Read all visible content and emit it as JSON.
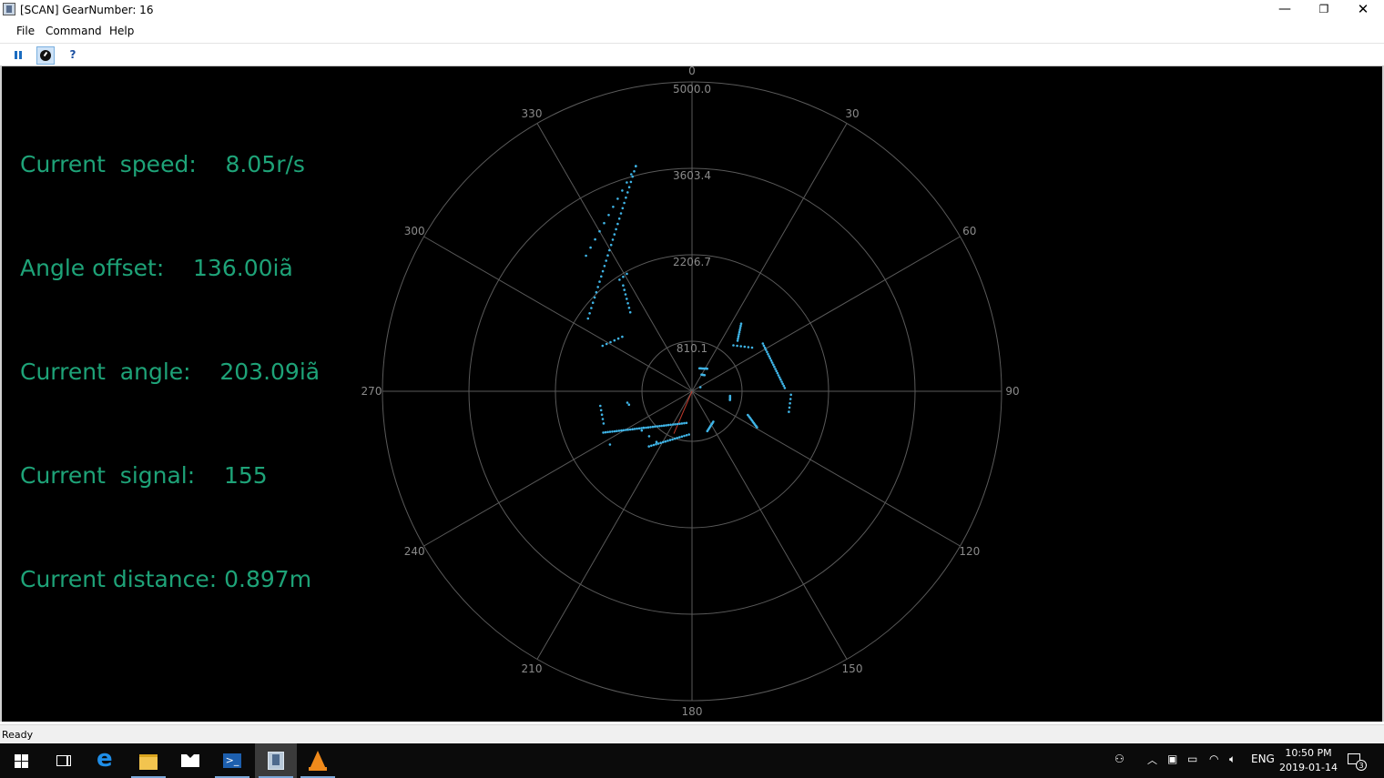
{
  "window": {
    "title": "[SCAN] GearNumber: 16",
    "controls": {
      "minimize": "—",
      "maximize": "❐",
      "close": "✕"
    }
  },
  "menu": {
    "items": [
      "File",
      "Command",
      "Help"
    ]
  },
  "toolbar": {
    "buttons": [
      {
        "name": "pause",
        "icon": "pause-icon"
      },
      {
        "name": "scan",
        "icon": "radar-icon",
        "pressed": true
      },
      {
        "name": "help",
        "icon": "help-icon",
        "label": "?"
      }
    ]
  },
  "info": {
    "speed": "Current  speed:    8.05r/s",
    "offset": "Angle offset:    136.00iã",
    "angle": "Current  angle:    203.09iã",
    "signal": "Current  signal:    155",
    "distance": "Current distance: 0.897m"
  },
  "chart_data": {
    "type": "scatter",
    "coordinate_system": "polar",
    "angle_labels": [
      "0",
      "30",
      "60",
      "90",
      "120",
      "150",
      "180",
      "210",
      "240",
      "270",
      "300",
      "330"
    ],
    "radius_labels": [
      "5000.0",
      "3603.4",
      "2206.7",
      "810.1"
    ],
    "colors": {
      "background": "#000000",
      "grid": "#5a5a5a",
      "points": "#3fb4e6",
      "heading": "#c0392b",
      "text": "#1ea378"
    },
    "heading_angle_deg": 203.09,
    "segments": [
      {
        "from": [
          -14,
          3750
        ],
        "to": [
          -55,
          2050
        ],
        "n": 30
      },
      {
        "from": [
          -14,
          3750
        ],
        "to": [
          -38,
          2780
        ],
        "n": 12
      },
      {
        "from": [
          -33,
          2040
        ],
        "to": [
          -38,
          1620
        ],
        "n": 7
      },
      {
        "from": [
          -29,
          2170
        ],
        "to": [
          -33,
          2150
        ],
        "n": 3
      },
      {
        "from": [
          -52,
          1430
        ],
        "to": [
          -63,
          1620
        ],
        "n": 6
      },
      {
        "from": [
          -99,
          1500
        ],
        "to": [
          -110,
          1520
        ],
        "n": 5
      },
      {
        "from": [
          -115,
          1580
        ],
        "to": [
          -170,
          520
        ],
        "n": 38
      },
      {
        "from": [
          -142,
          1130
        ],
        "to": [
          -176,
          700
        ],
        "n": 18
      },
      {
        "from": [
          -145,
          1000
        ],
        "to": [
          -128,
          1030
        ],
        "n": 3
      },
      {
        "from": [
          159,
          690
        ],
        "to": [
          145,
          600
        ],
        "n": 9
      },
      {
        "from": [
          36,
          1350
        ],
        "to": [
          42,
          1100
        ],
        "n": 9
      },
      {
        "from": [
          56,
          1380
        ],
        "to": [
          88,
          1500
        ],
        "n": 22
      },
      {
        "from": [
          42,
          1000
        ],
        "to": [
          54,
          1200
        ],
        "n": 6
      },
      {
        "from": [
          92,
          1600
        ],
        "to": [
          102,
          1600
        ],
        "n": 5
      },
      {
        "from": [
          113,
          980
        ],
        "to": [
          119,
          1200
        ],
        "n": 10
      },
      {
        "from": [
          18,
          390
        ],
        "to": [
          34,
          440
        ],
        "n": 8
      },
      {
        "from": [
          30,
          310
        ],
        "to": [
          38,
          330
        ],
        "n": 4
      },
      {
        "from": [
          97,
          620
        ],
        "to": [
          103,
          630
        ],
        "n": 4
      },
      {
        "from": [
          64,
          150
        ],
        "to": [
          64,
          150
        ],
        "n": 1
      },
      {
        "from": [
          -127,
          980
        ],
        "to": [
          -127,
          980
        ],
        "n": 1
      },
      {
        "from": [
          -102,
          1040
        ],
        "to": [
          -100,
          1060
        ],
        "n": 2
      },
      {
        "from": [
          -123,
          1580
        ],
        "to": [
          -123,
          1580
        ],
        "n": 1
      }
    ]
  },
  "statusbar": {
    "text": "Ready"
  },
  "taskbar": {
    "apps": [
      {
        "name": "start",
        "icon": "windows-icon"
      },
      {
        "name": "task-view",
        "icon": "task-view-icon"
      },
      {
        "name": "edge",
        "icon": "edge-icon"
      },
      {
        "name": "file-explorer",
        "icon": "folder-icon"
      },
      {
        "name": "mail",
        "icon": "mail-icon"
      },
      {
        "name": "powershell",
        "icon": "powershell-icon"
      },
      {
        "name": "scan-app",
        "icon": "scan-app-icon",
        "active": true
      },
      {
        "name": "vlc",
        "icon": "vlc-icon"
      }
    ],
    "tray": {
      "language": "ENG",
      "time": "10:50 PM",
      "date": "2019-01-14",
      "notifications": "3"
    }
  }
}
